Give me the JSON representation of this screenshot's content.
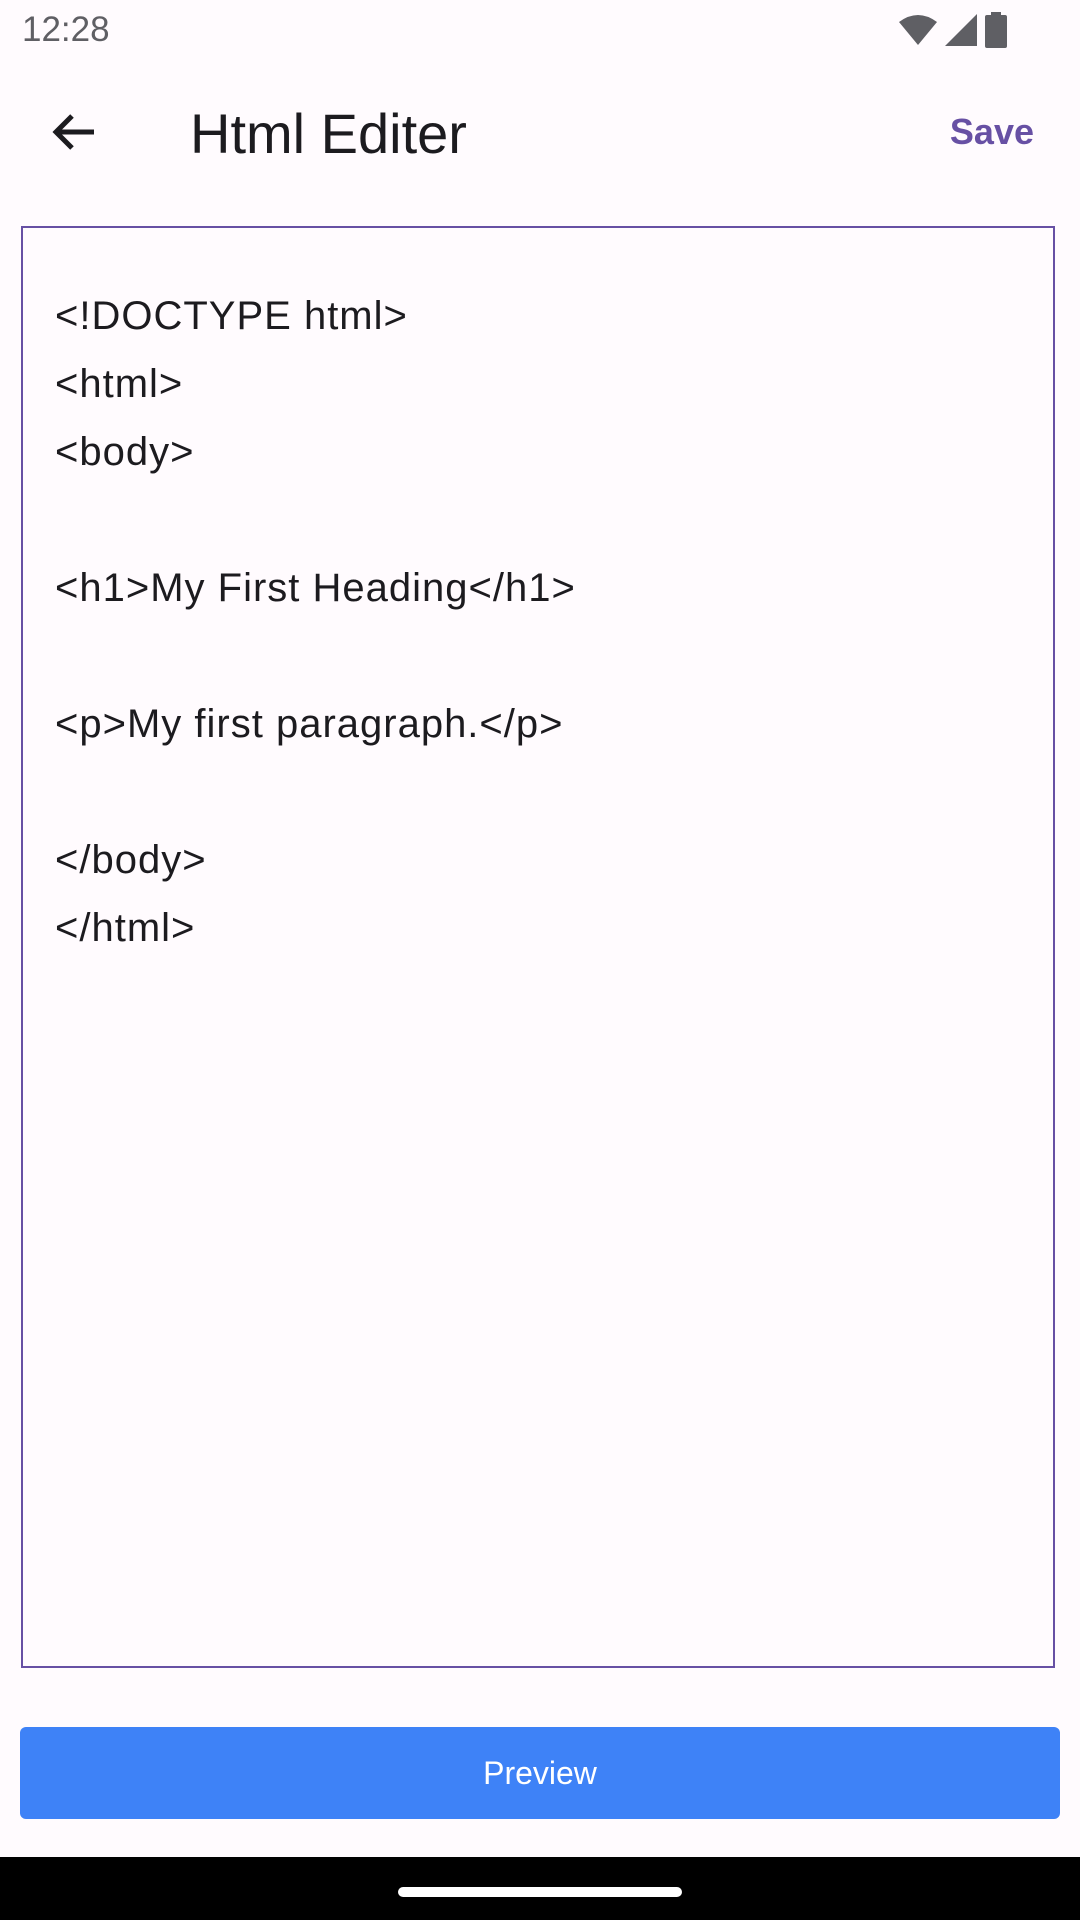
{
  "status_bar": {
    "time": "12:28",
    "icons": [
      "wifi-icon",
      "cellular-signal-icon",
      "battery-icon"
    ]
  },
  "app_bar": {
    "back_icon": "arrow-back-icon",
    "title": "Html Editer",
    "save_label": "Save"
  },
  "editor": {
    "content": "<!DOCTYPE html>\n<html>\n<body>\n\n<h1>My First Heading</h1>\n\n<p>My first paragraph.</p>\n\n</body>\n</html>"
  },
  "preview": {
    "label": "Preview"
  },
  "colors": {
    "accent": "#6750a4",
    "preview_button": "#3e82f7",
    "background": "#fffbfe"
  }
}
